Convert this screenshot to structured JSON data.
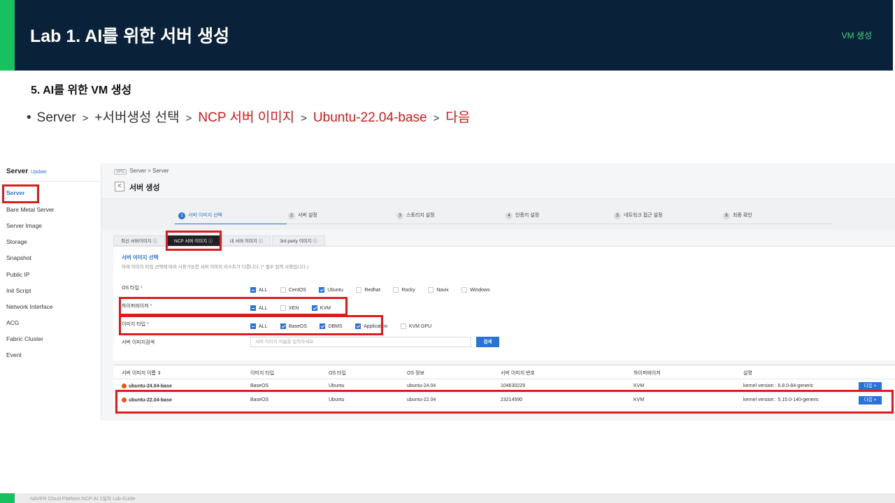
{
  "slide": {
    "title": "Lab 1. AI를 위한 서버 생성",
    "header_right": "VM 생성",
    "step_heading": "5.  AI를 위한 VM 생성",
    "bullet": {
      "part1": "Server",
      "sep": ">",
      "part2": "+서버생성 선택",
      "part3": "NCP 서버 이미지",
      "part4": "Ubuntu-22.04-base",
      "part5": "다음"
    },
    "footer": "NAVER Cloud Platform  NCP-AI 1일차 Lab Guide"
  },
  "sidebar": {
    "title": "Server",
    "update": "Update",
    "items": [
      "Server",
      "Bare Metal Server",
      "Server Image",
      "Storage",
      "Snapshot",
      "Public IP",
      "Init Script",
      "Network Interface",
      "ACG",
      "Fabric Cluster",
      "Event"
    ]
  },
  "main": {
    "breadcrumb_vpc": "VPC",
    "breadcrumb": "Server  >  Server",
    "back": "<",
    "page_title": "서버 생성",
    "wizard": [
      {
        "num": "1",
        "label": "서버 이미지 선택"
      },
      {
        "num": "2",
        "label": "서버 설정"
      },
      {
        "num": "3",
        "label": "스토리지 설정"
      },
      {
        "num": "4",
        "label": "인증키 설정"
      },
      {
        "num": "5",
        "label": "네트워크 접근 설정"
      },
      {
        "num": "6",
        "label": "최종 확인"
      }
    ],
    "tabs": [
      "최신 서버이미지 ⓘ",
      "NCP 서버 이미지 ⓘ",
      "내 서버 이미지 ⓘ",
      "3rd party 이미지 ⓘ"
    ],
    "section_title": "서버 이미지 선택",
    "section_desc": "아래 이미지 타입 선택에 따라 사용가능한 서버 이미지 리스트가 다릅니다. (* 필수 입력 사항입니다.)",
    "filters": {
      "os_label": "OS 타입",
      "os_opts": [
        "ALL",
        "CentOS",
        "Ubuntu",
        "Redhat",
        "Rocky",
        "Navix",
        "Windows"
      ],
      "hyper_label": "하이퍼바이저",
      "hyper_opts": [
        "ALL",
        "XEN",
        "KVM"
      ],
      "img_label": "이미지 타입",
      "img_opts": [
        "ALL",
        "BaseOS",
        "DBMS",
        "Application",
        "KVM GPU"
      ],
      "search_label": "서버 이미지검색",
      "search_placeholder": "서버 이미지 이름을 입력하세요.",
      "search_button": "검색",
      "req": "*"
    },
    "table": {
      "headers": [
        "서버 이미지 이름 ⇕",
        "이미지 타입",
        "OS 타입",
        "OS 정보",
        "서버 이미지 번호",
        "하이퍼바이저",
        "설명"
      ],
      "rows": [
        [
          "ubuntu-24.04-base",
          "BaseOS",
          "Ubuntu",
          "ubuntu-24.04",
          "104630229",
          "KVM",
          "kernel version : 6.8.0-84-generic"
        ],
        [
          "ubuntu-22.04-base",
          "BaseOS",
          "Ubuntu",
          "ubuntu-22.04",
          "23214590",
          "KVM",
          "kernel version : 5.15.0-140-generic"
        ]
      ],
      "next_label": "다음 >"
    }
  },
  "colors": {
    "header_bg": "#0a2239",
    "accent_green": "#17c15f",
    "highlight_red": "#e01b1b",
    "primary_blue": "#2a73d8"
  }
}
